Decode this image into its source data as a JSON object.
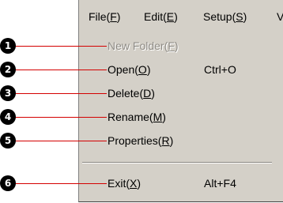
{
  "menubar": {
    "items": [
      {
        "text": "File(",
        "key": "F",
        "tail": ")"
      },
      {
        "text": "Edit(",
        "key": "E",
        "tail": ")"
      },
      {
        "text": "Setup(",
        "key": "S",
        "tail": ")"
      },
      {
        "text": "V"
      }
    ]
  },
  "dropdown": {
    "items": [
      {
        "text": "New Folder(",
        "key": "F",
        "tail": ")",
        "shortcut": ""
      },
      {
        "text": "Open(",
        "key": "O",
        "tail": ")",
        "shortcut": "Ctrl+O"
      },
      {
        "text": "Delete(",
        "key": "D",
        "tail": ")",
        "shortcut": ""
      },
      {
        "text": "Rename(",
        "key": "M",
        "tail": ")",
        "shortcut": ""
      },
      {
        "text": "Properties(",
        "key": "R",
        "tail": ")",
        "shortcut": ""
      },
      {
        "text": "Exit(",
        "key": "X",
        "tail": ")",
        "shortcut": "Alt+F4"
      }
    ]
  },
  "callouts": [
    "1",
    "2",
    "3",
    "4",
    "5",
    "6"
  ],
  "colors": {
    "callout_line": "#d40000",
    "menu_bg": "#d4d0c8"
  }
}
